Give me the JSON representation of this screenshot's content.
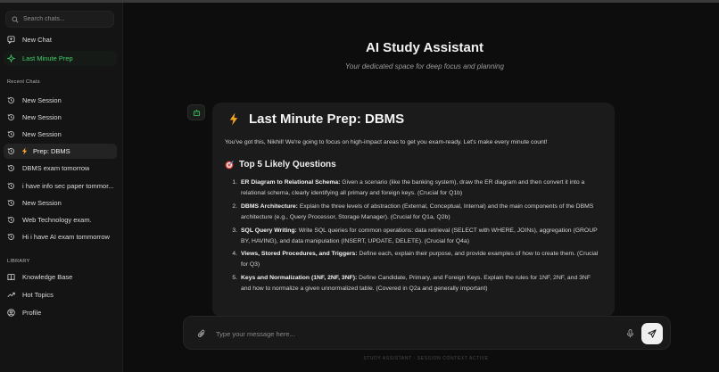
{
  "sidebar": {
    "search_placeholder": "Search chats...",
    "new_chat": "New Chat",
    "last_minute_prep": "Last Minute Prep",
    "recent_label": "Recent Chats",
    "recent": [
      {
        "label": "New Session",
        "icon": "history-icon"
      },
      {
        "label": "New Session",
        "icon": "history-icon"
      },
      {
        "label": "New Session",
        "icon": "history-icon"
      },
      {
        "label": "Prep: DBMS",
        "icon": "lightning-icon",
        "selected": true
      },
      {
        "label": "DBMS exam tomorrow",
        "icon": "history-icon"
      },
      {
        "label": "i have info sec paper tommor...",
        "icon": "history-icon"
      },
      {
        "label": "New Session",
        "icon": "history-icon"
      },
      {
        "label": "Web Technology exam.",
        "icon": "history-icon"
      },
      {
        "label": "Hi i have AI exam tommorrow",
        "icon": "history-icon"
      }
    ],
    "library_label": "LIBRARY",
    "library": [
      {
        "label": "Knowledge Base",
        "icon": "book-icon"
      },
      {
        "label": "Hot Topics",
        "icon": "trending-icon"
      },
      {
        "label": "Profile",
        "icon": "user-icon"
      }
    ]
  },
  "header": {
    "title": "AI Study Assistant",
    "subtitle": "Your dedicated space for deep focus and planning"
  },
  "message": {
    "title": "Last Minute Prep: DBMS",
    "intro": "You've got this, Nikhil! We're going to focus on high-impact areas to get you exam-ready. Let's make every minute count!",
    "questions_heading": "Top 5 Likely Questions",
    "questions": [
      {
        "num": "1.",
        "bold": "ER Diagram to Relational Schema:",
        "text": " Given a scenario (like the banking system), draw the ER diagram and then convert it into a relational schema, clearly identifying all primary and foreign keys. (Crucial for Q1b)"
      },
      {
        "num": "2.",
        "bold": "DBMS Architecture:",
        "text": " Explain the three levels of abstraction (External, Conceptual, Internal) and the main components of the DBMS architecture (e.g., Query Processor, Storage Manager). (Crucial for Q1a, Q2b)"
      },
      {
        "num": "3.",
        "bold": "SQL Query Writing:",
        "text": " Write SQL queries for common operations: data retrieval (SELECT with WHERE, JOINs), aggregation (GROUP BY, HAVING), and data manipulation (INSERT, UPDATE, DELETE). (Crucial for Q4a)"
      },
      {
        "num": "4.",
        "bold": "Views, Stored Procedures, and Triggers:",
        "text": " Define each, explain their purpose, and provide examples of how to create them. (Crucial for Q3)"
      },
      {
        "num": "5.",
        "bold": "Keys and Normalization (1NF, 2NF, 3NF):",
        "text": " Define Candidate, Primary, and Foreign Keys. Explain the rules for 1NF, 2NF, and 3NF and how to normalize a given unnormalized table. (Covered in Q2a and generally important)"
      }
    ]
  },
  "composer": {
    "placeholder": "Type your message here..."
  },
  "footer": "STUDY ASSISTANT - SESSION CONTEXT ACTIVE",
  "colors": {
    "accent_green": "#3fcf6a",
    "lightning_orange": "#f5a623",
    "background": "#0d0d0d"
  }
}
